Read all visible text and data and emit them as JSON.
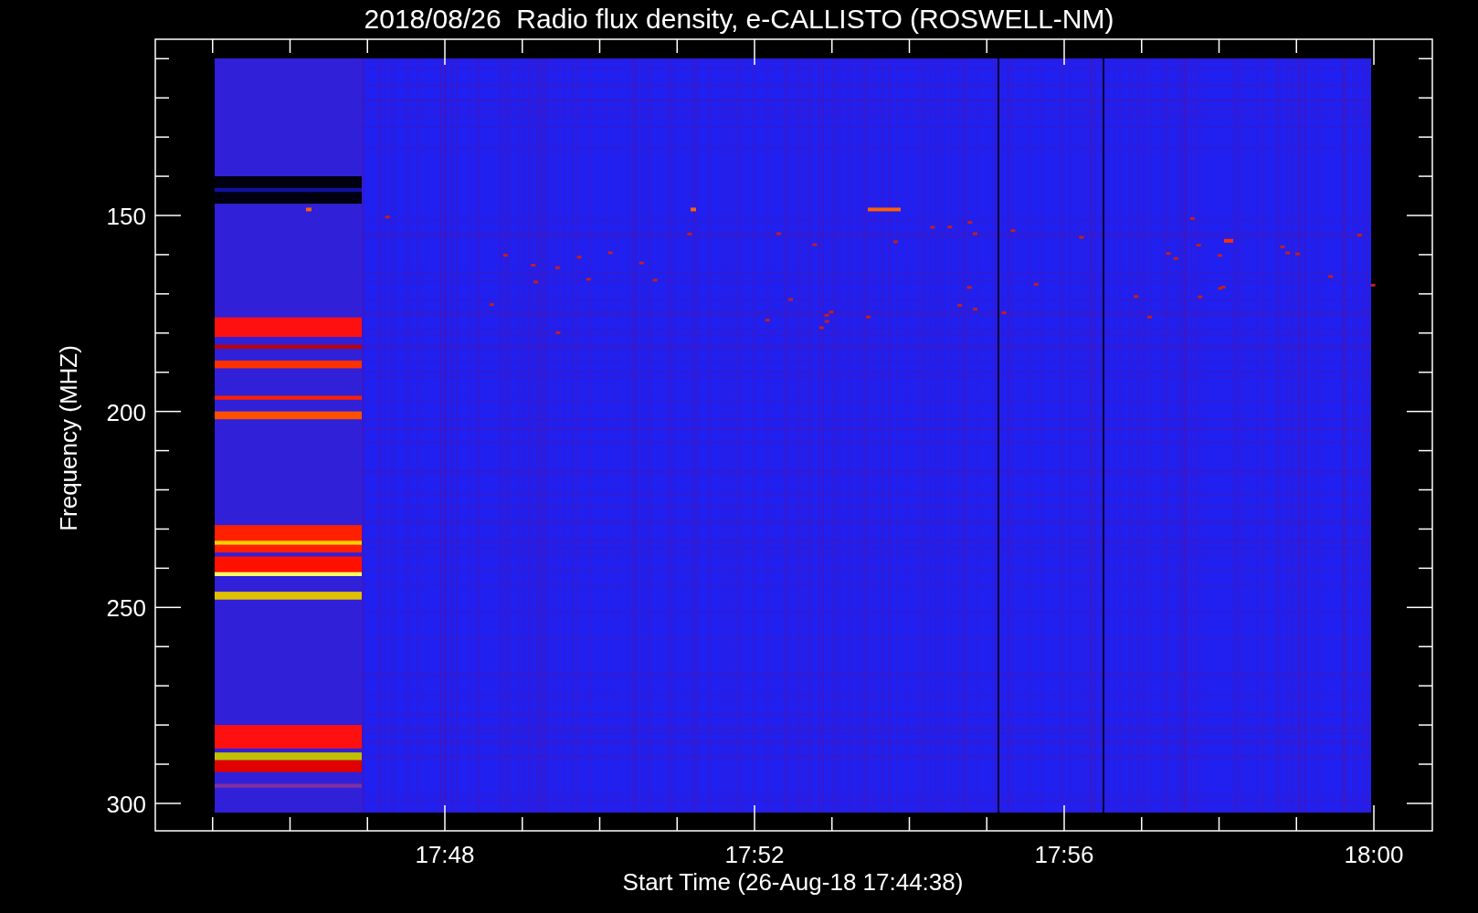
{
  "title": "2018/08/26  Radio flux density, e-CALLISTO (ROSWELL-NM)",
  "y_axis": {
    "label": "Frequency (MHZ)",
    "ticks": [
      "150",
      "200",
      "250",
      "300"
    ]
  },
  "x_axis": {
    "label": "Start Time (26-Aug-18 17:44:38)",
    "ticks": [
      "17:48",
      "17:52",
      "17:56",
      "18:00"
    ]
  }
}
